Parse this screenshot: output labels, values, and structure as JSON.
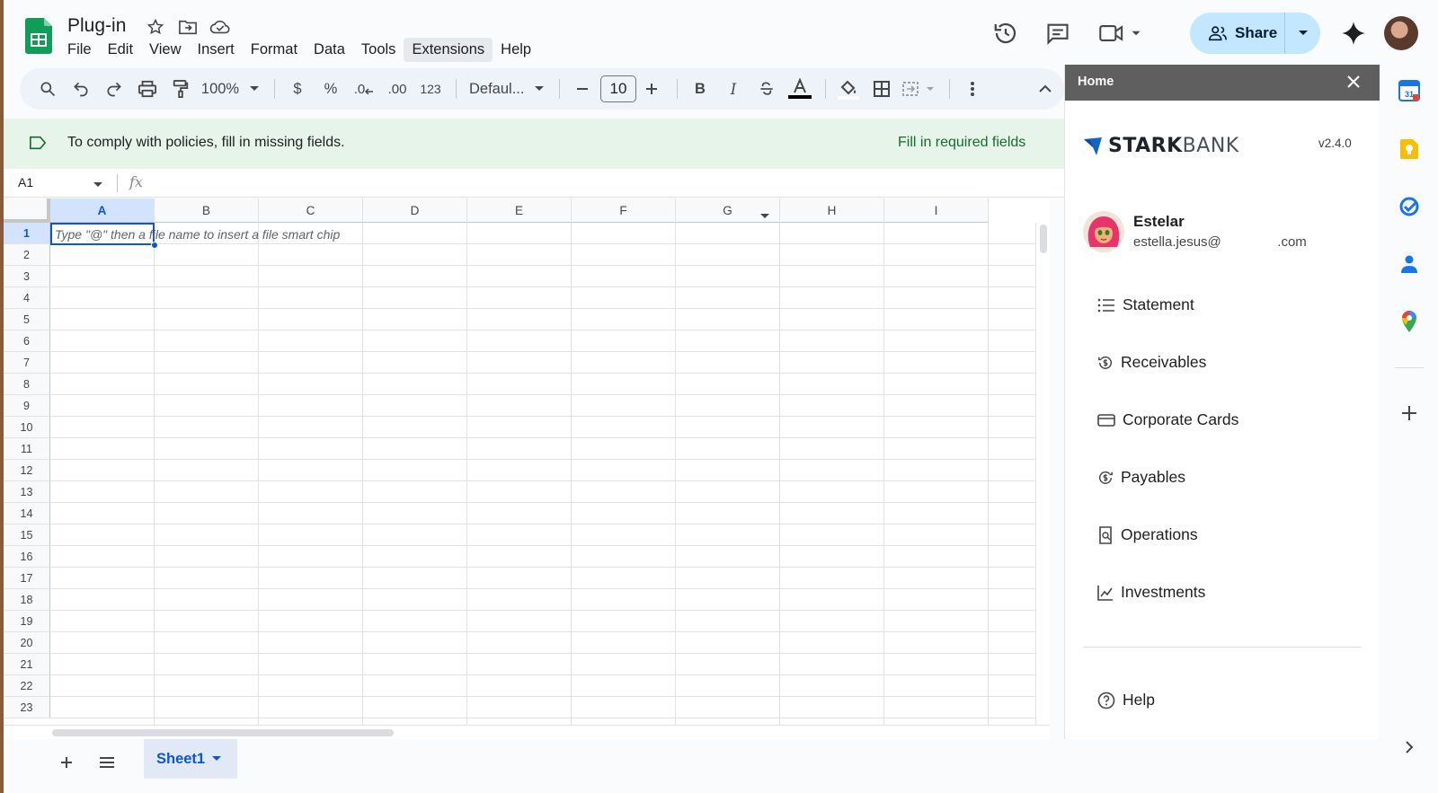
{
  "doc": {
    "title": "Plug-in"
  },
  "menu": [
    "File",
    "Edit",
    "View",
    "Insert",
    "Format",
    "Data",
    "Tools",
    "Extensions",
    "Help"
  ],
  "menu_active": "Extensions",
  "header": {
    "share_label": "Share"
  },
  "toolbar": {
    "zoom": "100%",
    "currency": "$",
    "percent": "%",
    "dec_decrease": ".0",
    "dec_increase": ".00",
    "number_format": "123",
    "font": "Defaul...",
    "font_size": "10",
    "bold": "B",
    "italic": "I"
  },
  "banner": {
    "text": "To comply with policies, fill in missing fields.",
    "link": "Fill in required fields"
  },
  "formula_bar": {
    "cell_ref": "A1",
    "fx": "fx"
  },
  "grid": {
    "columns": [
      "A",
      "B",
      "C",
      "D",
      "E",
      "F",
      "G",
      "H",
      "I"
    ],
    "rows": [
      "1",
      "2",
      "3",
      "4",
      "5",
      "6",
      "7",
      "8",
      "9",
      "10",
      "11",
      "12",
      "13",
      "14",
      "15",
      "16",
      "17",
      "18",
      "19",
      "20",
      "21",
      "22",
      "23"
    ],
    "selected_column": "A",
    "selected_row": "1",
    "cell_hint": "Type \"@\" then a file name to insert a file smart chip"
  },
  "sheets": {
    "active": "Sheet1"
  },
  "panel": {
    "title": "Home",
    "brand_strong": "STARK",
    "brand_light": "BANK",
    "version": "v2.4.0",
    "user_name": "Estelar",
    "user_email": "estella.jesus@               .com",
    "nav": [
      "Statement",
      "Receivables",
      "Corporate Cards",
      "Payables",
      "Operations",
      "Investments"
    ],
    "help": "Help"
  },
  "colors": {
    "sheets_green": "#0f9d58",
    "accent_blue": "#0b57d0",
    "share_bg": "#c2e7ff",
    "banner_bg": "#e6f4ea",
    "banner_link": "#146c2e",
    "panel_header": "#5f5f5f",
    "brand_blue": "#1565c0"
  },
  "icons": {
    "title": [
      "star-icon",
      "move-folder-icon",
      "cloud-status-icon"
    ],
    "header": [
      "version-history-icon",
      "comments-icon",
      "meet-icon",
      "gemini-icon"
    ],
    "rail": [
      "calendar-icon",
      "keep-icon",
      "tasks-icon",
      "contacts-icon",
      "maps-icon",
      "add-icon"
    ]
  }
}
